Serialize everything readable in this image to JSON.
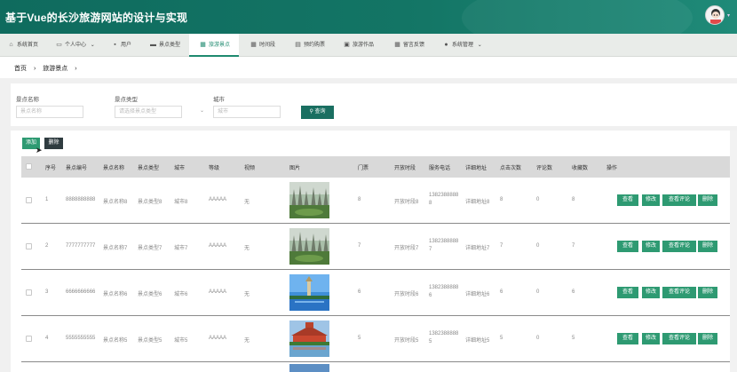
{
  "header": {
    "title": "基于Vue的长沙旅游网站的设计与实现",
    "avatar_caret": "▾"
  },
  "nav": [
    {
      "label": "系统首页",
      "icon": "home-icon",
      "glyph": "⌂"
    },
    {
      "label": "个人中心",
      "icon": "user-card-icon",
      "glyph": "▭",
      "caret": "⌄"
    },
    {
      "label": "用户",
      "icon": "user-icon",
      "glyph": "▪"
    },
    {
      "label": "景点类型",
      "icon": "comment-icon",
      "glyph": "▬"
    },
    {
      "label": "旅游景点",
      "icon": "grid-icon",
      "glyph": "▦",
      "active": true
    },
    {
      "label": "时间段",
      "icon": "grid-icon",
      "glyph": "▦"
    },
    {
      "label": "预约购票",
      "icon": "ticket-icon",
      "glyph": "▤"
    },
    {
      "label": "旅游作品",
      "icon": "printer-icon",
      "glyph": "▣"
    },
    {
      "label": "留言反馈",
      "icon": "grid-icon",
      "glyph": "▦"
    },
    {
      "label": "系统管理",
      "icon": "people-icon",
      "glyph": "●",
      "caret": "⌄"
    }
  ],
  "breadcrumb": {
    "home": "首页",
    "sep": "›",
    "current": "旅游景点"
  },
  "search": {
    "name_label": "景点名称",
    "name_placeholder": "景点名称",
    "type_label": "景点类型",
    "type_placeholder": "请选择景点类型",
    "type_arrow": "⌄",
    "city_label": "城市",
    "city_placeholder": "城市",
    "button": "⚲ 查询"
  },
  "toolbar": {
    "add": "添加",
    "delete": "删除"
  },
  "columns": [
    "序号",
    "景点编号",
    "景点名称",
    "景点类型",
    "城市",
    "等级",
    "视频",
    "图片",
    "门票",
    "开放时段",
    "服务电话",
    "详细地址",
    "点击次数",
    "评论数",
    "收藏数",
    "操作"
  ],
  "rows": [
    {
      "idx": "1",
      "code": "8888888888",
      "name": "景点名称8",
      "type": "景点类型8",
      "city": "城市8",
      "grade": "AAAAA",
      "video": "无",
      "ticket": "8",
      "hours": "开放时段8",
      "phone": "13823888888",
      "address": "详细地址8",
      "clicks": "8",
      "comments": "0",
      "favs": "8",
      "image": "karst-scene"
    },
    {
      "idx": "2",
      "code": "7777777777",
      "name": "景点名称7",
      "type": "景点类型7",
      "city": "城市7",
      "grade": "AAAAA",
      "video": "无",
      "ticket": "7",
      "hours": "开放时段7",
      "phone": "13823888887",
      "address": "详细地址7",
      "clicks": "7",
      "comments": "0",
      "favs": "7",
      "image": "karst-scene"
    },
    {
      "idx": "3",
      "code": "6666666666",
      "name": "景点名称6",
      "type": "景点类型6",
      "city": "城市6",
      "grade": "AAAAA",
      "video": "无",
      "ticket": "6",
      "hours": "开放时段6",
      "phone": "13823888886",
      "address": "详细地址6",
      "clicks": "6",
      "comments": "0",
      "favs": "6",
      "image": "pagoda-lake"
    },
    {
      "idx": "4",
      "code": "5555555555",
      "name": "景点名称5",
      "type": "景点类型5",
      "city": "城市5",
      "grade": "AAAAA",
      "video": "无",
      "ticket": "5",
      "hours": "开放时段5",
      "phone": "13823888885",
      "address": "详细地址5",
      "clicks": "5",
      "comments": "0",
      "favs": "5",
      "image": "temple-lake"
    }
  ],
  "actions": {
    "view": "查看",
    "edit": "修改",
    "view_comments": "查看评论",
    "delete": "删除"
  }
}
